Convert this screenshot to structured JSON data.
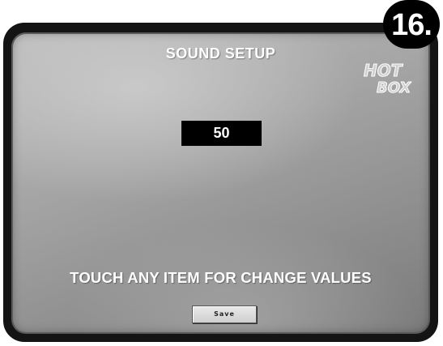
{
  "page": {
    "step_number": "16.",
    "title": "SOUND SETUP",
    "logo_text": "HOT BOX",
    "value_display": "50",
    "instruction": "TOUCH ANY ITEM FOR CHANGE VALUES",
    "save_label": "Save"
  },
  "colors": {
    "bezel": "#141414",
    "screen": "#a7a7a7",
    "value_box_bg": "#000000",
    "text": "#ffffff"
  }
}
